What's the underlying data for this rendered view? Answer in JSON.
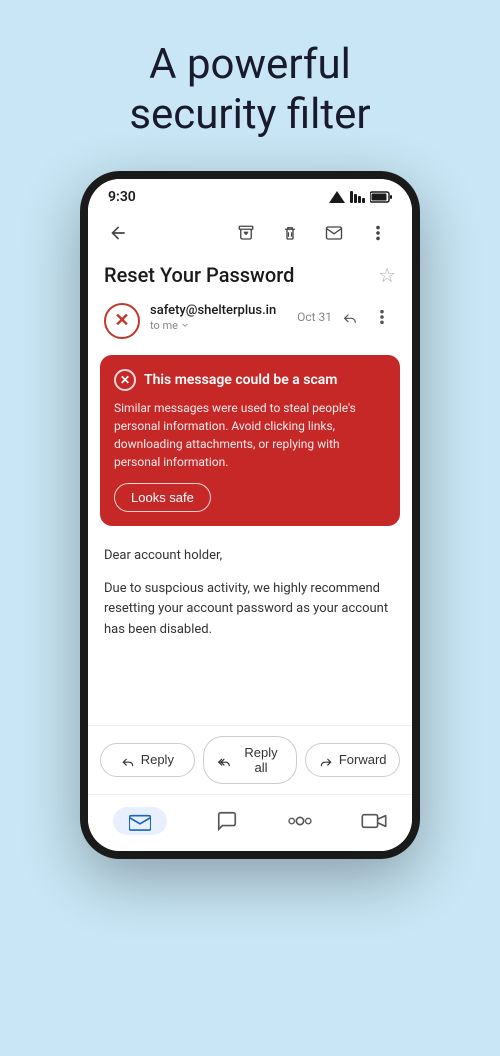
{
  "headline": {
    "line1": "A powerful",
    "line2": "security filter"
  },
  "status_bar": {
    "time": "9:30"
  },
  "toolbar": {
    "archive_title": "Archive",
    "delete_title": "Delete",
    "mark_title": "Mark as unread",
    "more_title": "More options"
  },
  "email": {
    "subject": "Reset Your Password",
    "sender": "safety@shelterplus.in",
    "date": "Oct 31",
    "to": "to me"
  },
  "warning": {
    "title": "This message could be a scam",
    "body": "Similar messages were used to steal people's personal information. Avoid clicking links, downloading attachments, or replying with personal information.",
    "looks_safe_label": "Looks safe"
  },
  "email_body": {
    "greeting": "Dear account holder,",
    "paragraph": "Due to suspcious activity, we highly recommend resetting your account password as your account has been disabled."
  },
  "reply_actions": {
    "reply_label": "Reply",
    "reply_all_label": "Reply all",
    "forward_label": "Forward"
  },
  "bottom_nav": {
    "mail_label": "Mail",
    "chat_label": "Chat",
    "spaces_label": "Spaces",
    "meet_label": "Meet"
  }
}
